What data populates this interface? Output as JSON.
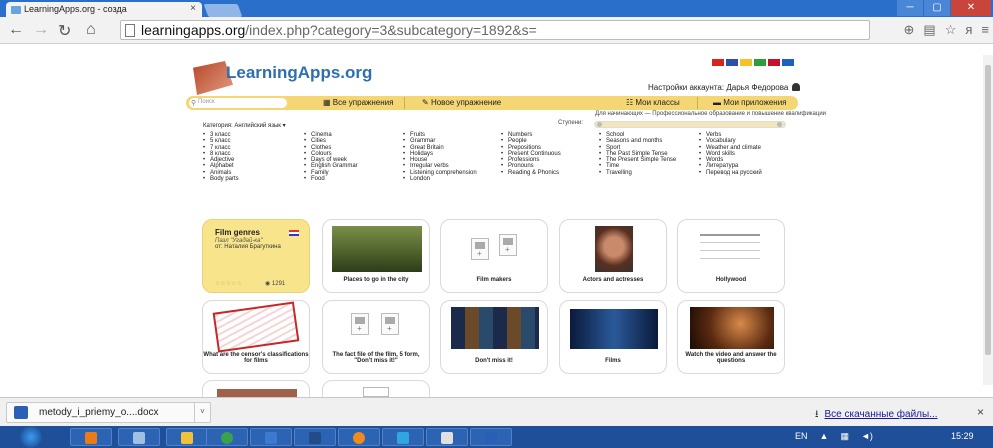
{
  "browser": {
    "tab_title": "LearningApps.org - созда",
    "tab_close": "×",
    "address_host": "learningapps.org",
    "address_path": "/index.php?category=3&subcategory=1892&s=",
    "win_min": "─",
    "win_max": "▢",
    "win_close": "✕",
    "right_icons": [
      "zoom-icon",
      "translate-icon",
      "star-icon",
      "extension-icon",
      "menu-icon"
    ]
  },
  "site": {
    "logo": "LearningApps.org",
    "account": "Настройки аккаунта: Дарья Федорова",
    "search_placeholder": "Поиск",
    "menu": {
      "all_exercises": "Все упражнения",
      "new_exercise": "Новое упражнение",
      "my_classes": "Мои классы",
      "my_apps": "Мои приложения"
    },
    "category_label": "Категория: Английский язык",
    "level_label": "Ступени:",
    "level_note": "Для начинающих — Профессиональное образование и повышение квалификации",
    "flag_colors": [
      "#d8231f",
      "#2e4fa3",
      "#f3c32b",
      "#2f9e3a",
      "#c8102e",
      "#1f5fbf"
    ]
  },
  "subcategories": {
    "col1": [
      "3 класс",
      "5 класс",
      "7 класс",
      "8 класс",
      "Adjective",
      "Alphabet",
      "Animals",
      "Body parts"
    ],
    "col2": [
      "Cinema",
      "Cities",
      "Clothes",
      "Colours",
      "Days of week",
      "English Grammar",
      "Family",
      "Food"
    ],
    "col3": [
      "Fruits",
      "Grammar",
      "Great Britain",
      "Holidays",
      "House",
      "Irregular verbs",
      "Listening comprehension",
      "London"
    ],
    "col4": [
      "Numbers",
      "People",
      "Prepositions",
      "Present Continuous",
      "Professions",
      "Pronouns",
      "Reading & Phonics"
    ],
    "col5": [
      "School",
      "Seasons and months",
      "Sport",
      "The Past Simple Tense",
      "The Present Simple Tense",
      "Time",
      "Travelling"
    ],
    "col6": [
      "Verbs",
      "Vocabulary",
      "Weather and climate",
      "Word skills",
      "Words",
      "Литература",
      "Перевод на русский"
    ]
  },
  "cards": {
    "featured": {
      "title": "Film genres",
      "subtitle": "Пазл \"Угадай-ка\"",
      "author": "от: Наталия Брагуткина",
      "stars": "☆☆☆☆☆",
      "views": "1291"
    },
    "c2": "Places to go in the city",
    "c3": "Film makers",
    "c4": "Actors and actresses",
    "c5": "Hollywood",
    "c6": "What are the censor's classifications for films",
    "c7": "The fact file of the film, 5 form, \"Don't miss it!\"",
    "c8": "Don't miss it!",
    "c9": "Films",
    "c10": "Watch the video and answer the questions"
  },
  "downloads": {
    "file": "metody_i_priemy_o....docx",
    "all": "Все скачанные файлы...",
    "close": "×"
  },
  "taskbar": {
    "lang": "EN",
    "time": "15:29"
  }
}
